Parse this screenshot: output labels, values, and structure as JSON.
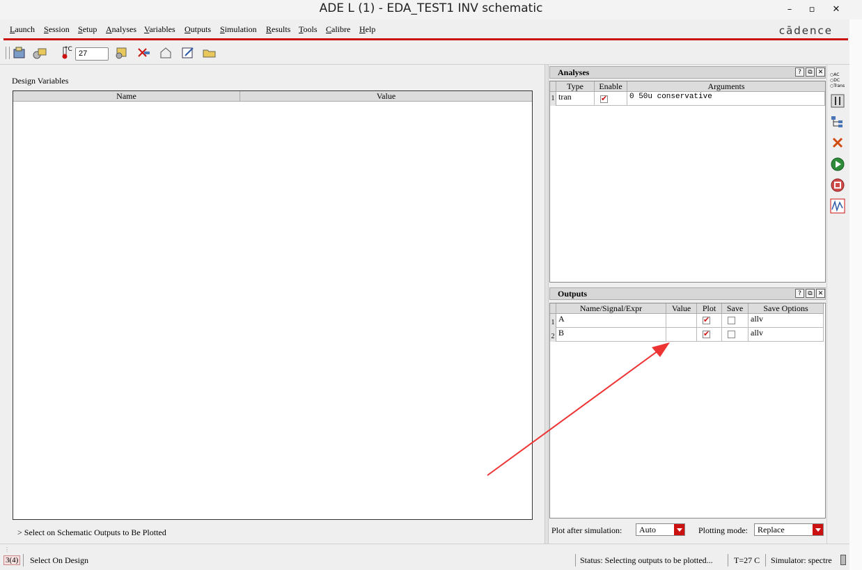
{
  "window": {
    "title": "ADE L (1) - EDA_TEST1 INV schematic",
    "minimize": "–",
    "maximize": "▫",
    "close": "✕"
  },
  "menu": {
    "items": [
      "Launch",
      "Session",
      "Setup",
      "Analyses",
      "Variables",
      "Outputs",
      "Simulation",
      "Results",
      "Tools",
      "Calibre",
      "Help"
    ],
    "brand": "cādence"
  },
  "toolbar": {
    "temperature_unit": "°C",
    "temperature_value": "27"
  },
  "design_variables": {
    "label": "Design Variables",
    "columns": [
      "Name",
      "Value"
    ],
    "status": "> Select on Schematic Outputs to Be Plotted"
  },
  "analyses": {
    "title": "Analyses",
    "help": "?",
    "columns": [
      "Type",
      "Enable",
      "Arguments"
    ],
    "rows": [
      {
        "index": "1",
        "type": "tran",
        "enabled": true,
        "arguments": "0 50u conservative"
      }
    ]
  },
  "outputs": {
    "title": "Outputs",
    "help": "?",
    "columns": [
      "Name/Signal/Expr",
      "Value",
      "Plot",
      "Save",
      "Save Options"
    ],
    "rows": [
      {
        "index": "1",
        "name": "A",
        "value": "",
        "plot": true,
        "save": false,
        "save_options": "allv"
      },
      {
        "index": "2",
        "name": "B",
        "value": "",
        "plot": true,
        "save": false,
        "save_options": "allv"
      }
    ],
    "plot_after_label": "Plot after simulation:",
    "plot_after_value": "Auto",
    "plotting_mode_label": "Plotting mode:",
    "plotting_mode_value": "Replace"
  },
  "sidebar": {
    "analysis_radio": [
      "AC",
      "DC",
      "Trans"
    ]
  },
  "statusbar": {
    "counter": "3(4)",
    "mode": "Select On Design",
    "status": "Status: Selecting outputs to be plotted...",
    "temperature": "T=27 C",
    "simulator": "Simulator: spectre"
  },
  "colors": {
    "accent_red": "#cc1111",
    "run_green": "#2e8b3a"
  }
}
